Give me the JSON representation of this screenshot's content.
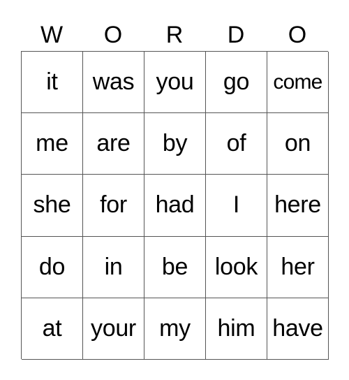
{
  "header": {
    "letters": [
      "W",
      "O",
      "R",
      "D",
      "O"
    ]
  },
  "board": {
    "rows": [
      [
        "it",
        "was",
        "you",
        "go",
        "come"
      ],
      [
        "me",
        "are",
        "by",
        "of",
        "on"
      ],
      [
        "she",
        "for",
        "had",
        "I",
        "here"
      ],
      [
        "do",
        "in",
        "be",
        "look",
        "her"
      ],
      [
        "at",
        "your",
        "my",
        "him",
        "have"
      ]
    ]
  }
}
